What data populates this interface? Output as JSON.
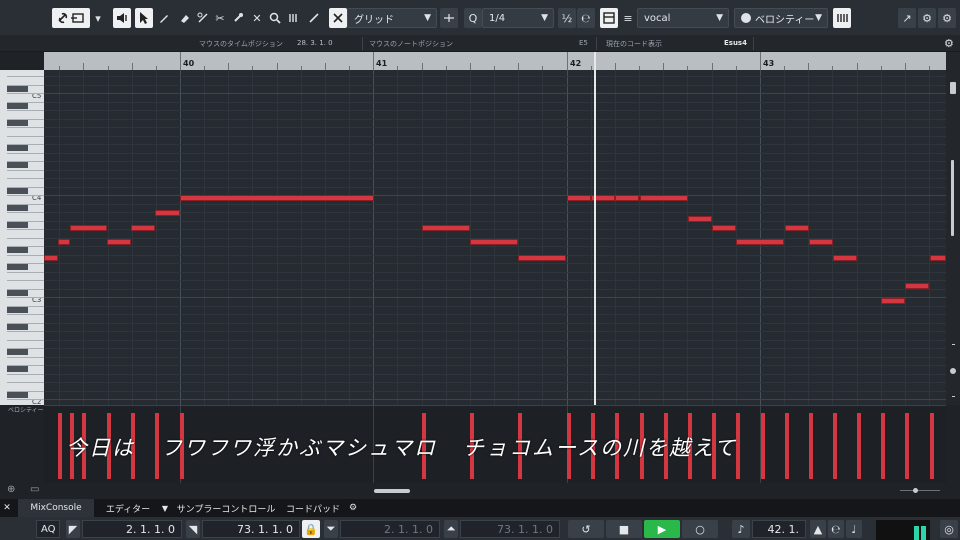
{
  "toolbar": {
    "grid_type": "グリッド",
    "quantize": "1/4",
    "track": "vocal",
    "lane": "ベロシティー",
    "q_label": "Q"
  },
  "infobar": {
    "mouse_time_label": "マウスのタイムポジション",
    "mouse_time_value": "28. 3. 1.   0",
    "mouse_note_label": "マウスのノートポジション",
    "mouse_note_value": "E5",
    "chord_label": "現在のコード表示",
    "chord_value": "Esus4"
  },
  "ruler": {
    "bars": [
      "40",
      "41",
      "42",
      "43"
    ]
  },
  "keyboard": {
    "labels": [
      "C5",
      "C4",
      "C3",
      "C2"
    ]
  },
  "velocity_label": "ベロシティー",
  "lyrics": "今日は   フワフワ浮かぶマシュマロ   チョコムースの川を越えて",
  "tabs": {
    "close": "✕",
    "mixconsole": "MixConsole",
    "editor": "エディター",
    "sampler": "サンプラーコントロール",
    "chordpad": "コードパッド"
  },
  "transport": {
    "aq": "AQ",
    "left_locator": "2. 1. 1.   0",
    "right_locator": "73. 1. 1.   0",
    "punch_in": "2. 1. 1.   0",
    "punch_out": "73. 1. 1.   0",
    "position": "42. 1."
  }
}
